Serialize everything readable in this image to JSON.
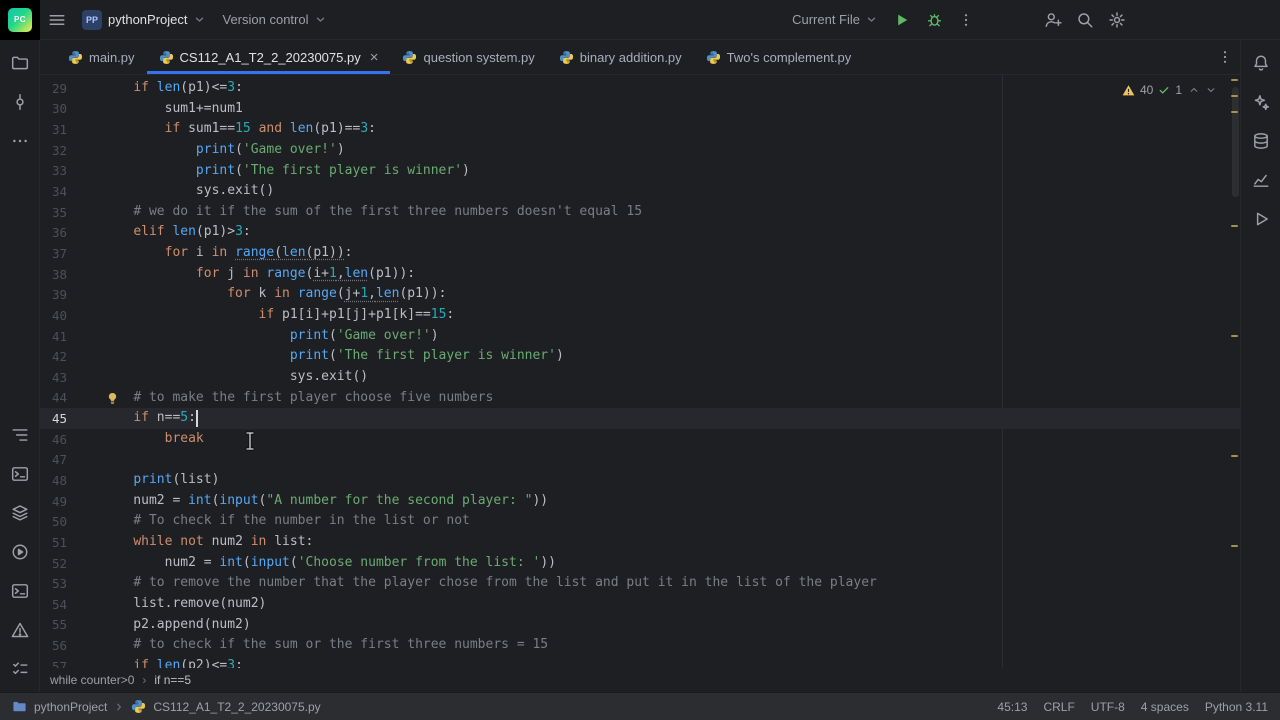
{
  "header": {
    "logo_text": "PC",
    "project_badge": "PP",
    "project_name": "pythonProject",
    "version_control_label": "Version control",
    "run_config_label": "Current File"
  },
  "tab_bar": {
    "tabs": [
      {
        "label": "main.py",
        "active": false
      },
      {
        "label": "CS112_A1_T2_2_20230075.py",
        "active": true
      },
      {
        "label": "question system.py",
        "active": false
      },
      {
        "label": "binary addition.py",
        "active": false
      },
      {
        "label": "Two's complement.py",
        "active": false
      }
    ]
  },
  "left_toolbar": {
    "top": [
      "project",
      "commit",
      "more"
    ],
    "bottom": [
      "structure",
      "python-console",
      "python-packages",
      "services",
      "terminal",
      "problems",
      "todo"
    ]
  },
  "right_toolbar": [
    "notifications",
    "ai-assistant",
    "database",
    "sciview",
    "run"
  ],
  "editor": {
    "current_line": 45,
    "inspections": {
      "warnings": "40",
      "typos": "1"
    },
    "lines": [
      {
        "n": 29,
        "segs": [
          [
            "    ",
            "d"
          ],
          [
            "if",
            "k"
          ],
          [
            " ",
            "d"
          ],
          [
            "len",
            "f"
          ],
          [
            "(p1)<=",
            "d"
          ],
          [
            "3",
            "n"
          ],
          [
            ":",
            "d"
          ]
        ]
      },
      {
        "n": 30,
        "segs": [
          [
            "        sum1+=num1",
            "d"
          ]
        ]
      },
      {
        "n": 31,
        "segs": [
          [
            "        ",
            "d"
          ],
          [
            "if",
            "k"
          ],
          [
            " sum1==",
            "d"
          ],
          [
            "15",
            "n"
          ],
          [
            " ",
            "d"
          ],
          [
            "and",
            "k"
          ],
          [
            " ",
            "d"
          ],
          [
            "len",
            "f"
          ],
          [
            "(p1)==",
            "d"
          ],
          [
            "3",
            "n"
          ],
          [
            ":",
            "d"
          ]
        ]
      },
      {
        "n": 32,
        "segs": [
          [
            "            ",
            "d"
          ],
          [
            "print",
            "f"
          ],
          [
            "(",
            "d"
          ],
          [
            "'Game over!'",
            "s"
          ],
          [
            ")",
            "d"
          ]
        ]
      },
      {
        "n": 33,
        "segs": [
          [
            "            ",
            "d"
          ],
          [
            "print",
            "f"
          ],
          [
            "(",
            "d"
          ],
          [
            "'The first player is winner'",
            "s"
          ],
          [
            ")",
            "d"
          ]
        ]
      },
      {
        "n": 34,
        "segs": [
          [
            "            sys.exit()",
            "d"
          ]
        ]
      },
      {
        "n": 35,
        "segs": [
          [
            "    ",
            "d"
          ],
          [
            "# we do it if the sum of the first three numbers doesn't equal 15",
            "c"
          ]
        ]
      },
      {
        "n": 36,
        "segs": [
          [
            "    ",
            "d"
          ],
          [
            "elif",
            "k"
          ],
          [
            " ",
            "d"
          ],
          [
            "len",
            "f"
          ],
          [
            "(p1)>",
            "d"
          ],
          [
            "3",
            "n"
          ],
          [
            ":",
            "d"
          ]
        ]
      },
      {
        "n": 37,
        "segs": [
          [
            "        ",
            "d"
          ],
          [
            "for",
            "k"
          ],
          [
            " i ",
            "d"
          ],
          [
            "in",
            "k"
          ],
          [
            " ",
            "d"
          ],
          [
            "range",
            "fu"
          ],
          [
            "(",
            "du"
          ],
          [
            "len",
            "fu"
          ],
          [
            "(p1))",
            "du"
          ],
          [
            ":",
            "d"
          ]
        ]
      },
      {
        "n": 38,
        "segs": [
          [
            "            ",
            "d"
          ],
          [
            "for",
            "k"
          ],
          [
            " j ",
            "d"
          ],
          [
            "in",
            "k"
          ],
          [
            " ",
            "d"
          ],
          [
            "range",
            "f"
          ],
          [
            "(",
            "d"
          ],
          [
            "i+",
            "du"
          ],
          [
            "1",
            "nu"
          ],
          [
            ",",
            "du"
          ],
          [
            "len",
            "fu"
          ],
          [
            "(p1)):",
            "d"
          ]
        ]
      },
      {
        "n": 39,
        "segs": [
          [
            "                ",
            "d"
          ],
          [
            "for",
            "k"
          ],
          [
            " k ",
            "d"
          ],
          [
            "in",
            "k"
          ],
          [
            " ",
            "d"
          ],
          [
            "range",
            "f"
          ],
          [
            "(",
            "d"
          ],
          [
            "j+",
            "du"
          ],
          [
            "1",
            "nu"
          ],
          [
            ",",
            "du"
          ],
          [
            "len",
            "fu"
          ],
          [
            "(p1)):",
            "d"
          ]
        ]
      },
      {
        "n": 40,
        "segs": [
          [
            "                    ",
            "d"
          ],
          [
            "if",
            "k"
          ],
          [
            " p1[i]+p1[j]+p1[k]==",
            "d"
          ],
          [
            "15",
            "n"
          ],
          [
            ":",
            "d"
          ]
        ]
      },
      {
        "n": 41,
        "segs": [
          [
            "                        ",
            "d"
          ],
          [
            "print",
            "f"
          ],
          [
            "(",
            "d"
          ],
          [
            "'Game over!'",
            "s"
          ],
          [
            ")",
            "d"
          ]
        ]
      },
      {
        "n": 42,
        "segs": [
          [
            "                        ",
            "d"
          ],
          [
            "print",
            "f"
          ],
          [
            "(",
            "d"
          ],
          [
            "'The first player is winner'",
            "s"
          ],
          [
            ")",
            "d"
          ]
        ]
      },
      {
        "n": 43,
        "segs": [
          [
            "                        sys.exit()",
            "d"
          ]
        ]
      },
      {
        "n": 44,
        "segs": [
          [
            "    ",
            "d"
          ],
          [
            "# to make the first player choose five numbers",
            "c"
          ]
        ],
        "bulb": true
      },
      {
        "n": 45,
        "segs": [
          [
            "    ",
            "d"
          ],
          [
            "if",
            "k"
          ],
          [
            " n==",
            "d"
          ],
          [
            "5",
            "n"
          ],
          [
            ":",
            "d"
          ]
        ],
        "caret_after": true
      },
      {
        "n": 46,
        "segs": [
          [
            "        ",
            "d"
          ],
          [
            "break",
            "k"
          ]
        ]
      },
      {
        "n": 47,
        "segs": []
      },
      {
        "n": 48,
        "segs": [
          [
            "    ",
            "d"
          ],
          [
            "print",
            "f"
          ],
          [
            "(list)",
            "d"
          ]
        ]
      },
      {
        "n": 49,
        "segs": [
          [
            "    num2 = ",
            "d"
          ],
          [
            "int",
            "f"
          ],
          [
            "(",
            "d"
          ],
          [
            "input",
            "f"
          ],
          [
            "(",
            "d"
          ],
          [
            "\"A number for the second player: \"",
            "s"
          ],
          [
            "))",
            "d"
          ]
        ]
      },
      {
        "n": 50,
        "segs": [
          [
            "    ",
            "d"
          ],
          [
            "# To check if the number in the list or not",
            "c"
          ]
        ]
      },
      {
        "n": 51,
        "segs": [
          [
            "    ",
            "d"
          ],
          [
            "while",
            "k"
          ],
          [
            " ",
            "d"
          ],
          [
            "not",
            "k"
          ],
          [
            " num2 ",
            "d"
          ],
          [
            "in",
            "k"
          ],
          [
            " list:",
            "d"
          ]
        ]
      },
      {
        "n": 52,
        "segs": [
          [
            "        num2 = ",
            "d"
          ],
          [
            "int",
            "f"
          ],
          [
            "(",
            "d"
          ],
          [
            "input",
            "f"
          ],
          [
            "(",
            "d"
          ],
          [
            "'Choose number from the list: '",
            "s"
          ],
          [
            "))",
            "d"
          ]
        ]
      },
      {
        "n": 53,
        "segs": [
          [
            "    ",
            "d"
          ],
          [
            "# to remove the number that the player chose from the list and put it in the list of the player",
            "c"
          ]
        ]
      },
      {
        "n": 54,
        "segs": [
          [
            "    list.remove(num2)",
            "d"
          ]
        ]
      },
      {
        "n": 55,
        "segs": [
          [
            "    p2.append(num2)",
            "d"
          ]
        ]
      },
      {
        "n": 56,
        "segs": [
          [
            "    ",
            "d"
          ],
          [
            "# to check if the sum or the first three numbers = 15",
            "c"
          ]
        ]
      },
      {
        "n": 57,
        "segs": [
          [
            "    ",
            "d"
          ],
          [
            "if",
            "k"
          ],
          [
            " ",
            "d"
          ],
          [
            "len",
            "f"
          ],
          [
            "(p2)<=",
            "d"
          ],
          [
            "3",
            "n"
          ],
          [
            ":",
            "d"
          ]
        ]
      }
    ]
  },
  "breadcrumbs": {
    "items": [
      "while counter>0",
      "if n==5"
    ]
  },
  "statusbar": {
    "project": "pythonProject",
    "file": "CS112_A1_T2_2_20230075.py",
    "cursor_position": "45:13",
    "line_separator": "CRLF",
    "encoding": "UTF-8",
    "indent": "4 spaces",
    "interpreter": "Python 3.11"
  },
  "colors": {
    "accent": "#3574f0",
    "keyword": "#cf8e6d",
    "string": "#6aab73",
    "number": "#2aacb8",
    "builtin": "#56a8f5",
    "comment": "#7a7e85",
    "warning": "#f2c55c",
    "run_green": "#5fb865"
  }
}
